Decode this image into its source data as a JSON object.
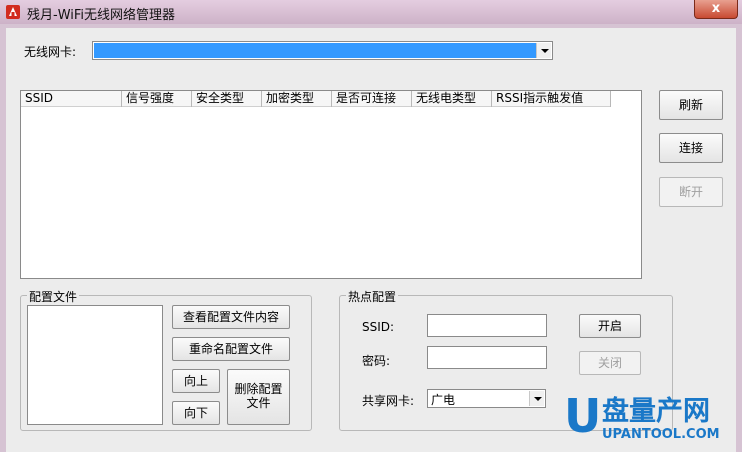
{
  "window": {
    "title": "残月-WiFi无线网络管理器",
    "close_glyph": "x"
  },
  "adapter": {
    "label": "无线网卡:",
    "selected_value": ""
  },
  "network_table": {
    "columns": [
      "SSID",
      "信号强度",
      "安全类型",
      "加密类型",
      "是否可连接",
      "无线电类型",
      "RSSI指示触发值"
    ],
    "rows": []
  },
  "side_buttons": {
    "refresh": "刷新",
    "connect": "连接",
    "disconnect": "断开"
  },
  "profiles": {
    "group_title": "配置文件",
    "items": [],
    "view_content": "查看配置文件内容",
    "rename": "重命名配置文件",
    "move_up": "向上",
    "move_down": "向下",
    "delete_line1": "删除配置",
    "delete_line2": "文件"
  },
  "hotspot": {
    "group_title": "热点配置",
    "ssid_label": "SSID:",
    "ssid_value": "",
    "password_label": "密码:",
    "password_value": "",
    "share_label": "共享网卡:",
    "share_value": "广电",
    "start": "开启",
    "stop": "关闭"
  },
  "watermark": {
    "letter": "U",
    "brand": "盘量产网",
    "site": "UPANTOOL.COM"
  },
  "colors": {
    "selection": "#3399ff",
    "close": "#c84a32",
    "watermark_blue": "#1a78c8"
  }
}
